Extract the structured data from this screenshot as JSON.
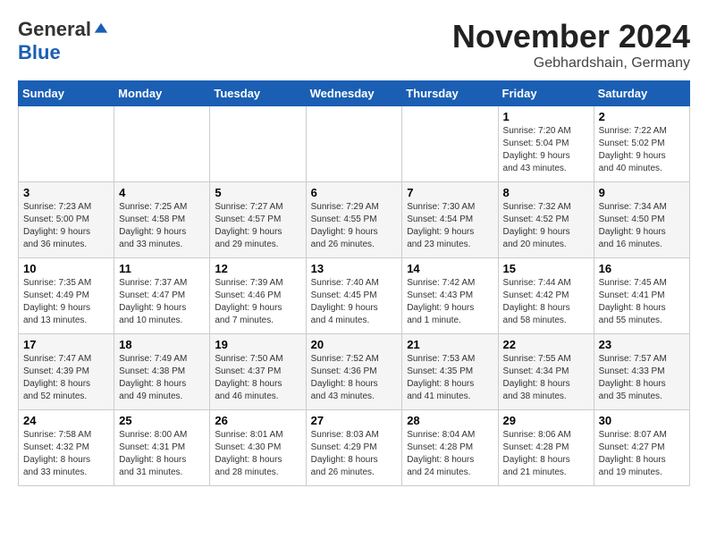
{
  "header": {
    "logo_general": "General",
    "logo_blue": "Blue",
    "month": "November 2024",
    "location": "Gebhardshain, Germany"
  },
  "days_of_week": [
    "Sunday",
    "Monday",
    "Tuesday",
    "Wednesday",
    "Thursday",
    "Friday",
    "Saturday"
  ],
  "weeks": [
    [
      {
        "day": "",
        "info": ""
      },
      {
        "day": "",
        "info": ""
      },
      {
        "day": "",
        "info": ""
      },
      {
        "day": "",
        "info": ""
      },
      {
        "day": "",
        "info": ""
      },
      {
        "day": "1",
        "info": "Sunrise: 7:20 AM\nSunset: 5:04 PM\nDaylight: 9 hours\nand 43 minutes."
      },
      {
        "day": "2",
        "info": "Sunrise: 7:22 AM\nSunset: 5:02 PM\nDaylight: 9 hours\nand 40 minutes."
      }
    ],
    [
      {
        "day": "3",
        "info": "Sunrise: 7:23 AM\nSunset: 5:00 PM\nDaylight: 9 hours\nand 36 minutes."
      },
      {
        "day": "4",
        "info": "Sunrise: 7:25 AM\nSunset: 4:58 PM\nDaylight: 9 hours\nand 33 minutes."
      },
      {
        "day": "5",
        "info": "Sunrise: 7:27 AM\nSunset: 4:57 PM\nDaylight: 9 hours\nand 29 minutes."
      },
      {
        "day": "6",
        "info": "Sunrise: 7:29 AM\nSunset: 4:55 PM\nDaylight: 9 hours\nand 26 minutes."
      },
      {
        "day": "7",
        "info": "Sunrise: 7:30 AM\nSunset: 4:54 PM\nDaylight: 9 hours\nand 23 minutes."
      },
      {
        "day": "8",
        "info": "Sunrise: 7:32 AM\nSunset: 4:52 PM\nDaylight: 9 hours\nand 20 minutes."
      },
      {
        "day": "9",
        "info": "Sunrise: 7:34 AM\nSunset: 4:50 PM\nDaylight: 9 hours\nand 16 minutes."
      }
    ],
    [
      {
        "day": "10",
        "info": "Sunrise: 7:35 AM\nSunset: 4:49 PM\nDaylight: 9 hours\nand 13 minutes."
      },
      {
        "day": "11",
        "info": "Sunrise: 7:37 AM\nSunset: 4:47 PM\nDaylight: 9 hours\nand 10 minutes."
      },
      {
        "day": "12",
        "info": "Sunrise: 7:39 AM\nSunset: 4:46 PM\nDaylight: 9 hours\nand 7 minutes."
      },
      {
        "day": "13",
        "info": "Sunrise: 7:40 AM\nSunset: 4:45 PM\nDaylight: 9 hours\nand 4 minutes."
      },
      {
        "day": "14",
        "info": "Sunrise: 7:42 AM\nSunset: 4:43 PM\nDaylight: 9 hours\nand 1 minute."
      },
      {
        "day": "15",
        "info": "Sunrise: 7:44 AM\nSunset: 4:42 PM\nDaylight: 8 hours\nand 58 minutes."
      },
      {
        "day": "16",
        "info": "Sunrise: 7:45 AM\nSunset: 4:41 PM\nDaylight: 8 hours\nand 55 minutes."
      }
    ],
    [
      {
        "day": "17",
        "info": "Sunrise: 7:47 AM\nSunset: 4:39 PM\nDaylight: 8 hours\nand 52 minutes."
      },
      {
        "day": "18",
        "info": "Sunrise: 7:49 AM\nSunset: 4:38 PM\nDaylight: 8 hours\nand 49 minutes."
      },
      {
        "day": "19",
        "info": "Sunrise: 7:50 AM\nSunset: 4:37 PM\nDaylight: 8 hours\nand 46 minutes."
      },
      {
        "day": "20",
        "info": "Sunrise: 7:52 AM\nSunset: 4:36 PM\nDaylight: 8 hours\nand 43 minutes."
      },
      {
        "day": "21",
        "info": "Sunrise: 7:53 AM\nSunset: 4:35 PM\nDaylight: 8 hours\nand 41 minutes."
      },
      {
        "day": "22",
        "info": "Sunrise: 7:55 AM\nSunset: 4:34 PM\nDaylight: 8 hours\nand 38 minutes."
      },
      {
        "day": "23",
        "info": "Sunrise: 7:57 AM\nSunset: 4:33 PM\nDaylight: 8 hours\nand 35 minutes."
      }
    ],
    [
      {
        "day": "24",
        "info": "Sunrise: 7:58 AM\nSunset: 4:32 PM\nDaylight: 8 hours\nand 33 minutes."
      },
      {
        "day": "25",
        "info": "Sunrise: 8:00 AM\nSunset: 4:31 PM\nDaylight: 8 hours\nand 31 minutes."
      },
      {
        "day": "26",
        "info": "Sunrise: 8:01 AM\nSunset: 4:30 PM\nDaylight: 8 hours\nand 28 minutes."
      },
      {
        "day": "27",
        "info": "Sunrise: 8:03 AM\nSunset: 4:29 PM\nDaylight: 8 hours\nand 26 minutes."
      },
      {
        "day": "28",
        "info": "Sunrise: 8:04 AM\nSunset: 4:28 PM\nDaylight: 8 hours\nand 24 minutes."
      },
      {
        "day": "29",
        "info": "Sunrise: 8:06 AM\nSunset: 4:28 PM\nDaylight: 8 hours\nand 21 minutes."
      },
      {
        "day": "30",
        "info": "Sunrise: 8:07 AM\nSunset: 4:27 PM\nDaylight: 8 hours\nand 19 minutes."
      }
    ]
  ]
}
